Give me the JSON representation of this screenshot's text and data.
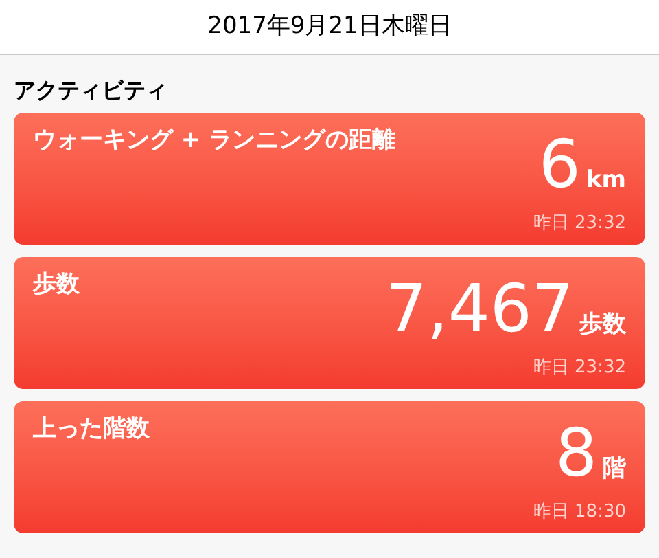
{
  "header": {
    "date": "2017年9月21日木曜日"
  },
  "section": {
    "title": "アクティビティ"
  },
  "cards": [
    {
      "title": "ウォーキング + ランニングの距離",
      "value": "6",
      "unit": "km",
      "time": "昨日 23:32"
    },
    {
      "title": "歩数",
      "value": "7,467",
      "unit": "歩数",
      "time": "昨日 23:32"
    },
    {
      "title": "上った階数",
      "value": "8",
      "unit": "階",
      "time": "昨日 18:30"
    }
  ]
}
